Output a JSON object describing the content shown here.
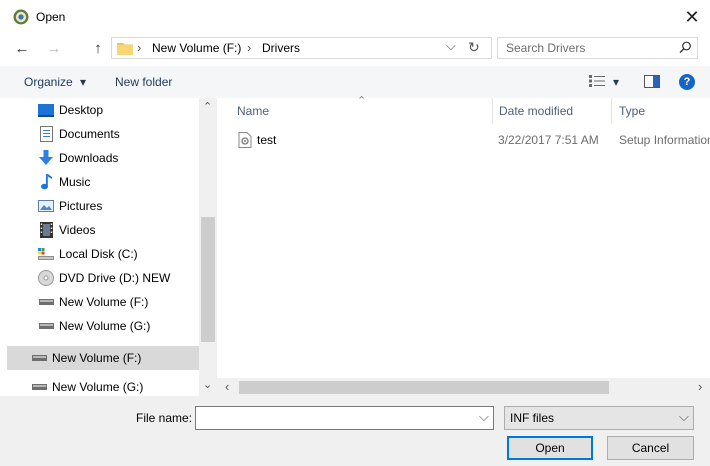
{
  "window": {
    "title": "Open",
    "close_glyph": "✕",
    "icon": "app-icon"
  },
  "nav": {
    "back_glyph": "←",
    "forward_glyph": "→",
    "up_glyph": "↑",
    "breadcrumb": [
      {
        "label": "New Volume (F:)"
      },
      {
        "label": "Drivers"
      }
    ],
    "separator_glyph": "›",
    "dropdown_glyph": "⌵",
    "refresh_glyph": "↻",
    "search": {
      "placeholder": "Search Drivers",
      "value": ""
    }
  },
  "toolbar": {
    "organize_label": "Organize",
    "organize_caret": "▾",
    "new_folder_label": "New folder",
    "view_caret": "▾",
    "help_glyph": "?"
  },
  "sidebar": {
    "items": [
      {
        "label": "Desktop",
        "icon": "desktop-icon"
      },
      {
        "label": "Documents",
        "icon": "documents-icon"
      },
      {
        "label": "Downloads",
        "icon": "downloads-icon"
      },
      {
        "label": "Music",
        "icon": "music-icon"
      },
      {
        "label": "Pictures",
        "icon": "pictures-icon"
      },
      {
        "label": "Videos",
        "icon": "videos-icon"
      },
      {
        "label": "Local Disk (C:)",
        "icon": "local-disk-icon"
      },
      {
        "label": "DVD Drive (D:) NEW",
        "icon": "dvd-drive-icon"
      },
      {
        "label": "New Volume (F:)",
        "icon": "drive-icon"
      },
      {
        "label": "New Volume (G:)",
        "icon": "drive-icon"
      }
    ],
    "section_items": [
      {
        "label": "New Volume (F:)",
        "icon": "drive-icon",
        "selected": true
      },
      {
        "label": "New Volume (G:)",
        "icon": "drive-icon",
        "selected": false
      }
    ],
    "scroll_up_glyph": "⌃",
    "scroll_down_glyph": "⌄"
  },
  "file_list": {
    "columns": [
      "Name",
      "Date modified",
      "Type"
    ],
    "sort_glyph": "⌃",
    "rows": [
      {
        "name": "test",
        "date_modified": "3/22/2017 7:51 AM",
        "type": "Setup Information",
        "icon": "setup-file-icon"
      }
    ],
    "scroll_left_glyph": "‹",
    "scroll_right_glyph": "›"
  },
  "footer": {
    "file_name_label": "File name:",
    "file_name_value": "",
    "file_name_caret": "⌵",
    "file_type_value": "INF files",
    "file_type_caret": "⌵",
    "open_label": "Open",
    "cancel_label": "Cancel"
  },
  "colors": {
    "selection": "#d9d9d9",
    "accent": "#0078d7",
    "command_bar": "#f5f6f7",
    "footer": "#f0f0f0"
  }
}
